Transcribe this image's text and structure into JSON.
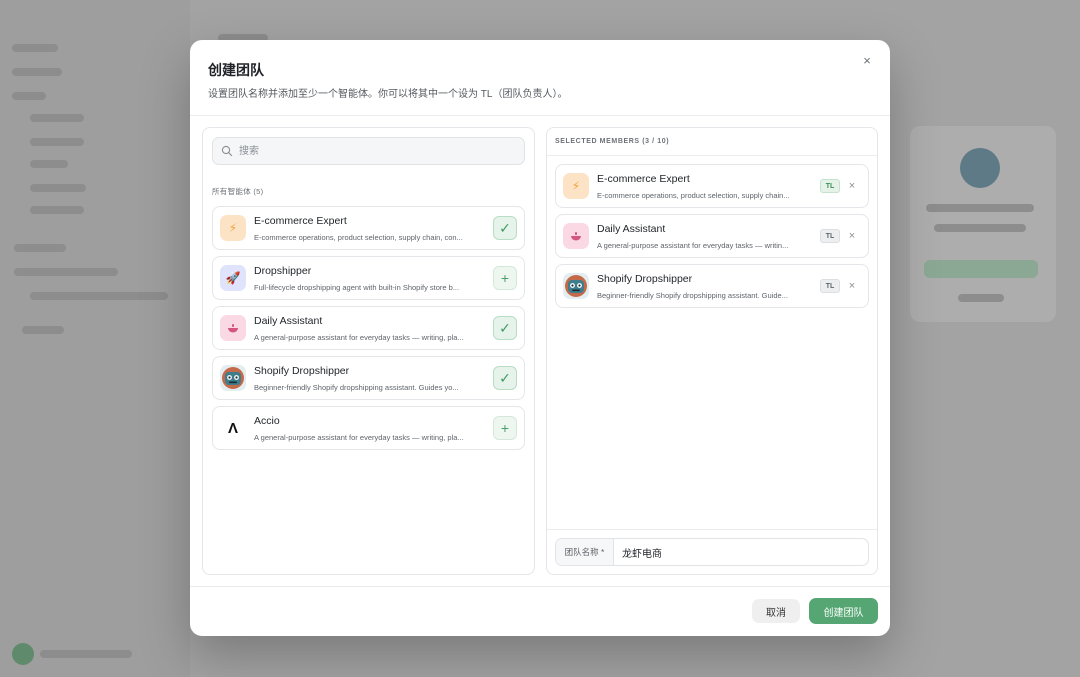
{
  "modal": {
    "title": "创建团队",
    "subtitle": "设置团队名称并添加至少一个智能体。你可以将其中一个设为 TL（团队负责人）。",
    "close_glyph": "×"
  },
  "search": {
    "placeholder": "搜索"
  },
  "agents_section_label": "所有智能体 (5)",
  "agents": [
    {
      "name": "E-commerce Expert",
      "description": "E-commerce operations, product selection, supply chain, con...",
      "icon": "bolt-icon",
      "state": "checked"
    },
    {
      "name": "Dropshipper",
      "description": "Full-lifecycle dropshipping agent with built-in Shopify store b...",
      "icon": "rocket-icon",
      "state": "add"
    },
    {
      "name": "Daily Assistant",
      "description": "A general-purpose assistant for everyday tasks — writing, pla...",
      "icon": "bowl-icon",
      "state": "checked"
    },
    {
      "name": "Shopify Dropshipper",
      "description": "Beginner-friendly Shopify dropshipping assistant. Guides yo...",
      "icon": "robot-icon",
      "state": "checked"
    },
    {
      "name": "Accio",
      "description": "A general-purpose assistant for everyday tasks — writing, pla...",
      "icon": "accio-logo-icon",
      "state": "add"
    }
  ],
  "selected_header": "SELECTED MEMBERS (3 / 10)",
  "members": [
    {
      "name": "E-commerce Expert",
      "description": "E-commerce operations, product selection, supply chain...",
      "icon": "bolt-icon",
      "tl_label": "TL",
      "tl_active": true
    },
    {
      "name": "Daily Assistant",
      "description": "A general-purpose assistant for everyday tasks — writin...",
      "icon": "bowl-icon",
      "tl_label": "TL",
      "tl_active": false
    },
    {
      "name": "Shopify Dropshipper",
      "description": "Beginner-friendly Shopify dropshipping assistant. Guide...",
      "icon": "robot-icon",
      "tl_label": "TL",
      "tl_active": false
    }
  ],
  "team_name": {
    "label": "团队名称 *",
    "value": "龙虾电商"
  },
  "buttons": {
    "cancel": "取消",
    "create": "创建团队"
  },
  "glyphs": {
    "check": "✓",
    "plus": "+",
    "remove": "×",
    "bolt": "⚡",
    "rocket": "🚀",
    "accio": "Λ"
  },
  "colors": {
    "accent": "#56a673",
    "check_bg": "#e6f3ea",
    "overlay": "#a3a3a3"
  }
}
